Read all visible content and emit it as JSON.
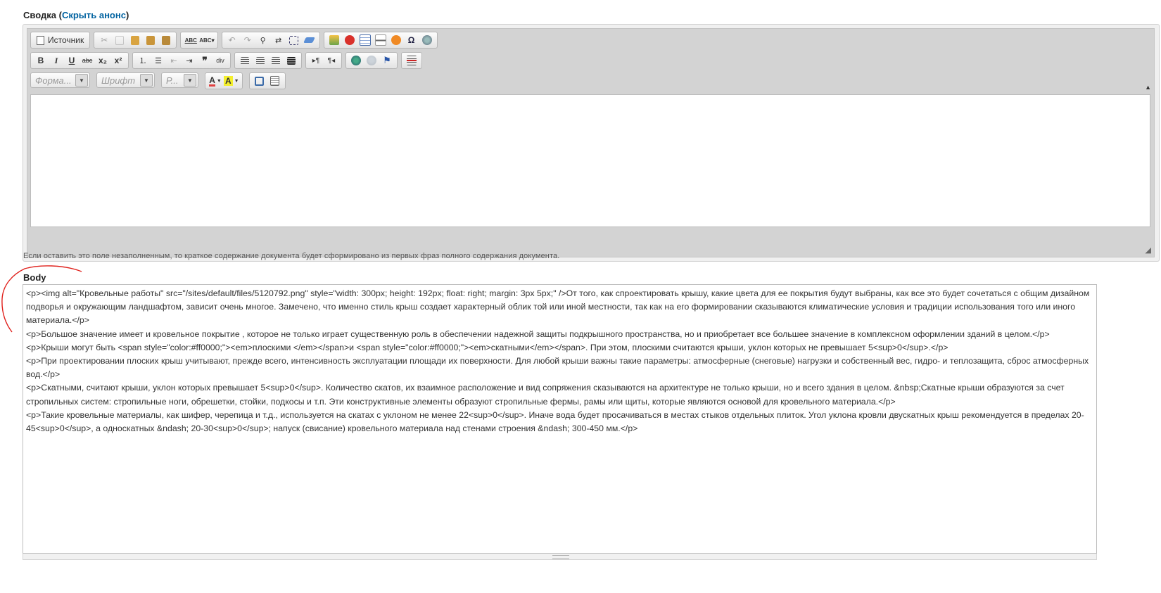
{
  "summary": {
    "label": "Сводка",
    "open_paren": "(",
    "toggle_link": "Скрыть анонс",
    "close_paren": ")"
  },
  "editor": {
    "toolbar": {
      "source_label": "Источник",
      "format_placeholder": "Форма...",
      "font_placeholder": "Шрифт",
      "size_placeholder": "Р...",
      "bold": "B",
      "italic": "I",
      "underline": "U",
      "strike": "abc",
      "subscript": "x₂",
      "superscript": "x²",
      "spell": "ABC",
      "spell2": "ABC▾"
    }
  },
  "hint": "Если оставить это поле незаполненным, то краткое содержание документа будет сформировано из первых фраз полного содержания документа.",
  "body": {
    "label": "Body",
    "lines": [
      "<p><img alt=\"Кровельные работы\" src=\"/sites/default/files/5120792.png\" style=\"width: 300px; height: 192px; float: right; margin: 3px 5px;\" />От того, как спроектировать крышу, какие цвета для ее покрытия будут выбраны, как все это будет сочетаться с общим дизайном подворья и окружающим ландшафтом, зависит очень многое. Замечено, что именно стиль крыш создает характерный облик той или иной местности, так как на его формировании сказываются климатические условия и традиции использования того или иного материала.</p>",
      "<p>Большое значение имеет и кровельное покрытие , которое не только играет существенную роль в обеспечении надежной защиты подкрышного пространства, но и приобретает все большее значение в комплексном оформлении зданий в целом.</p>",
      "<p>Крыши могут быть <span style=\"color:#ff0000;\"><em>плоскими </em></span>и <span style=\"color:#ff0000;\"><em>скатными</em></span>. При этом, плоскими считаются крыши, уклон которых не превышает 5<sup>0</sup>.</p>",
      "<p>При проектировании плоских крыш учитывают, прежде всего, интенсивность эксплуатации площади их поверхности. Для любой крыши важны такие параметры: атмосферные (снеговые) нагрузки и собственный вес, гидро- и теплозащита, сброс атмосферных вод.</p>",
      "<p>Скатными, считают крыши, уклон которых превышает 5<sup>0</sup>. Количество скатов, их взаимное расположение и вид сопряжения сказываются на архитектуре не только крыши, но и всего здания в целом. &nbsp;Скатные крыши образуются за счет стропильных систем: стропильные ноги, обрешетки, стойки, подкосы и т.п. Эти конструктивные элементы образуют стропильные фермы, рамы или щиты, которые являются основой для кровельного материала.</p>",
      "<p>Такие кровельные материалы, как шифер, черепица и т.д., используется на скатах с уклоном не менее 22<sup>0</sup>. Иначе вода будет просачиваться в местах стыков отдельных плиток. Угол уклона кровли двускатных крыш рекомендуется в пределах 20-45<sup>0</sup>, а односкатных &ndash; 20-30<sup>0</sup>; напуск (свисание) кровельного материала над стенами строения &ndash; 300-450 мм.</p>"
    ]
  },
  "colors": {
    "link": "#0062a0",
    "annotation": "#e0201b"
  }
}
